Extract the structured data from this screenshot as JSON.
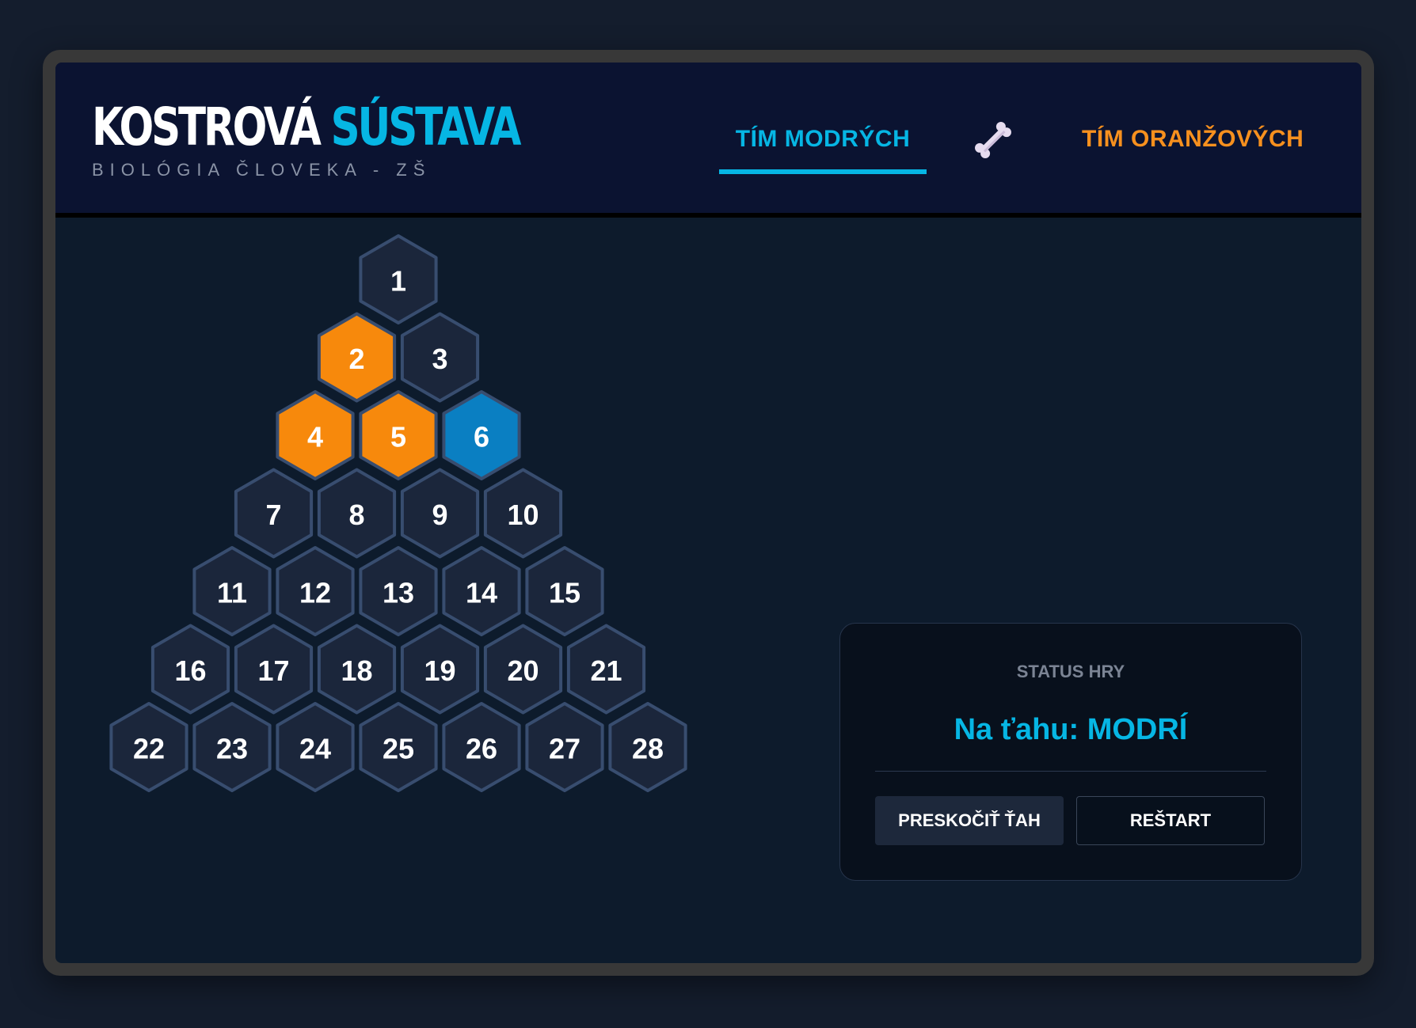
{
  "header": {
    "title_part1": "KOSTROVÁ",
    "title_part2": "SÚSTAVA",
    "subtitle": "BIOLÓGIA ČLOVEKA - ZŠ",
    "team_blue": "TÍM MODRÝCH",
    "team_orange": "TÍM ORANŽOVÝCH",
    "active_team": "blue",
    "center_icon": "bone-icon"
  },
  "colors": {
    "blue": "#0a7fc2",
    "orange": "#f7890c",
    "empty": "#1b263b",
    "hex_border": "#384d6f",
    "accent_blue": "#06b6e4",
    "accent_orange": "#f7901e"
  },
  "board": {
    "rows": 7,
    "cells": [
      {
        "n": "1",
        "owner": "none"
      },
      {
        "n": "2",
        "owner": "orange"
      },
      {
        "n": "3",
        "owner": "none"
      },
      {
        "n": "4",
        "owner": "orange"
      },
      {
        "n": "5",
        "owner": "orange"
      },
      {
        "n": "6",
        "owner": "blue"
      },
      {
        "n": "7",
        "owner": "none"
      },
      {
        "n": "8",
        "owner": "none"
      },
      {
        "n": "9",
        "owner": "none"
      },
      {
        "n": "10",
        "owner": "none"
      },
      {
        "n": "11",
        "owner": "none"
      },
      {
        "n": "12",
        "owner": "none"
      },
      {
        "n": "13",
        "owner": "none"
      },
      {
        "n": "14",
        "owner": "none"
      },
      {
        "n": "15",
        "owner": "none"
      },
      {
        "n": "16",
        "owner": "none"
      },
      {
        "n": "17",
        "owner": "none"
      },
      {
        "n": "18",
        "owner": "none"
      },
      {
        "n": "19",
        "owner": "none"
      },
      {
        "n": "20",
        "owner": "none"
      },
      {
        "n": "21",
        "owner": "none"
      },
      {
        "n": "22",
        "owner": "none"
      },
      {
        "n": "23",
        "owner": "none"
      },
      {
        "n": "24",
        "owner": "none"
      },
      {
        "n": "25",
        "owner": "none"
      },
      {
        "n": "26",
        "owner": "none"
      },
      {
        "n": "27",
        "owner": "none"
      },
      {
        "n": "28",
        "owner": "none"
      }
    ]
  },
  "status": {
    "label": "STATUS HRY",
    "turn_text": "Na ťahu: MODRÍ",
    "skip_button": "PRESKOČIŤ ŤAH",
    "restart_button": "REŠTART"
  }
}
